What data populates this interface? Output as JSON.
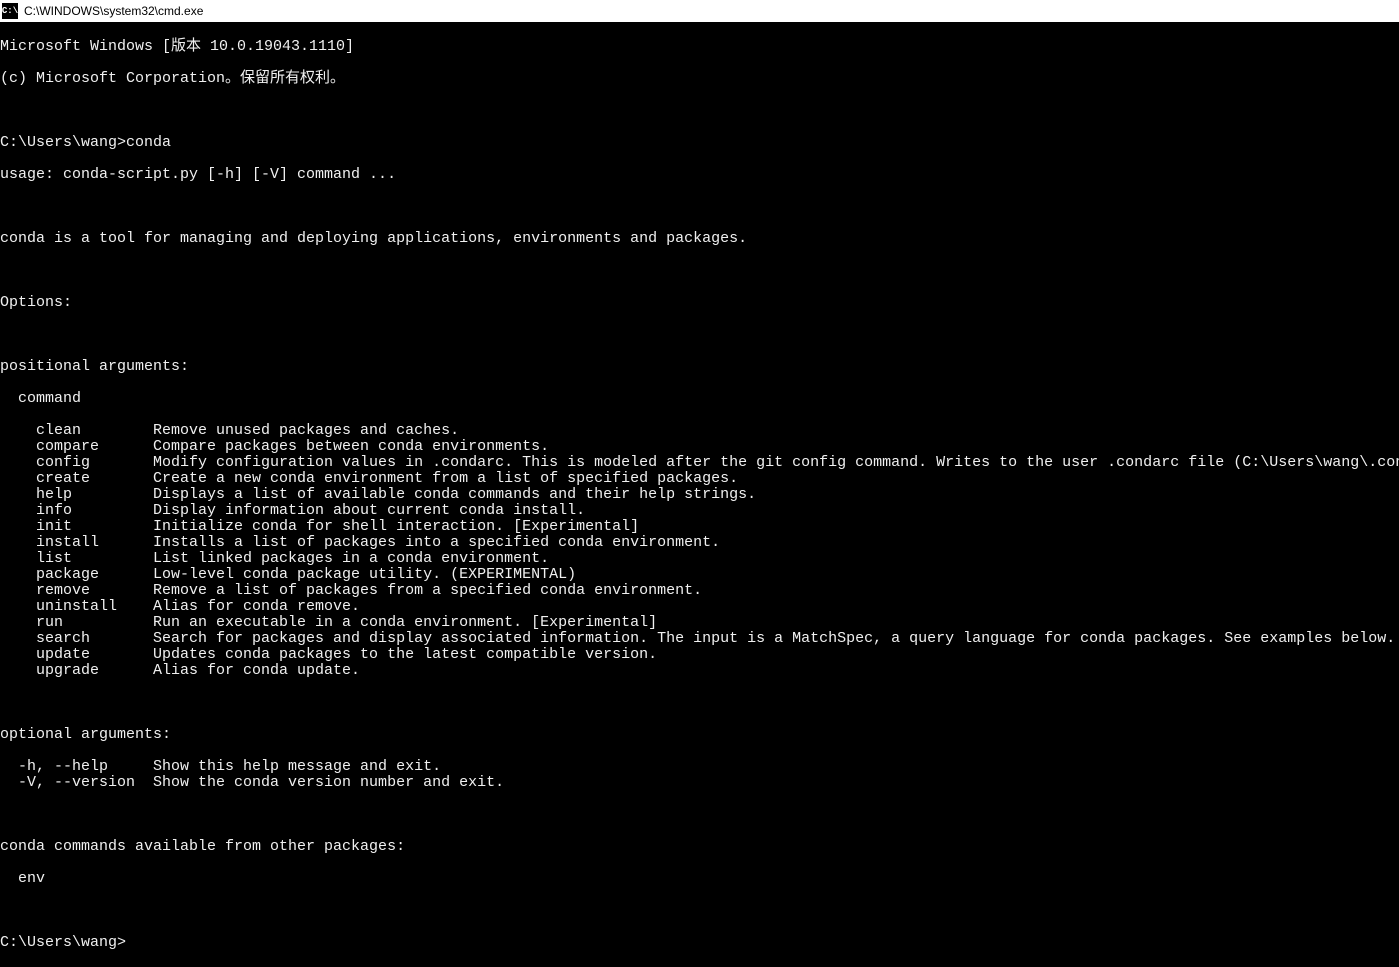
{
  "title_bar": {
    "icon_label": "C:\\",
    "title": "C:\\WINDOWS\\system32\\cmd.exe"
  },
  "terminal": {
    "header1": "Microsoft Windows [版本 10.0.19043.1110]",
    "header2": "(c) Microsoft Corporation。保留所有权利。",
    "prompt1": "C:\\Users\\wang>conda",
    "usage": "usage: conda-script.py [-h] [-V] command ...",
    "description": "conda is a tool for managing and deploying applications, environments and packages.",
    "options_header": "Options:",
    "positional_header": "positional arguments:",
    "command_label": "  command",
    "commands": [
      {
        "name": "    clean",
        "pad": "        ",
        "desc": "Remove unused packages and caches."
      },
      {
        "name": "    compare",
        "pad": "      ",
        "desc": "Compare packages between conda environments."
      },
      {
        "name": "    config",
        "pad": "       ",
        "desc": "Modify configuration values in .condarc. This is modeled after the git config command. Writes to the user .condarc file (C:\\Users\\wang\\.condarc) by default."
      },
      {
        "name": "    create",
        "pad": "       ",
        "desc": "Create a new conda environment from a list of specified packages."
      },
      {
        "name": "    help",
        "pad": "         ",
        "desc": "Displays a list of available conda commands and their help strings."
      },
      {
        "name": "    info",
        "pad": "         ",
        "desc": "Display information about current conda install."
      },
      {
        "name": "    init",
        "pad": "         ",
        "desc": "Initialize conda for shell interaction. [Experimental]"
      },
      {
        "name": "    install",
        "pad": "      ",
        "desc": "Installs a list of packages into a specified conda environment."
      },
      {
        "name": "    list",
        "pad": "         ",
        "desc": "List linked packages in a conda environment."
      },
      {
        "name": "    package",
        "pad": "      ",
        "desc": "Low-level conda package utility. (EXPERIMENTAL)"
      },
      {
        "name": "    remove",
        "pad": "       ",
        "desc": "Remove a list of packages from a specified conda environment."
      },
      {
        "name": "    uninstall",
        "pad": "    ",
        "desc": "Alias for conda remove."
      },
      {
        "name": "    run",
        "pad": "          ",
        "desc": "Run an executable in a conda environment. [Experimental]"
      },
      {
        "name": "    search",
        "pad": "       ",
        "desc": "Search for packages and display associated information. The input is a MatchSpec, a query language for conda packages. See examples below."
      },
      {
        "name": "    update",
        "pad": "       ",
        "desc": "Updates conda packages to the latest compatible version."
      },
      {
        "name": "    upgrade",
        "pad": "      ",
        "desc": "Alias for conda update."
      }
    ],
    "optional_header": "optional arguments:",
    "optionals": [
      {
        "flag": "  -h, --help",
        "pad": "     ",
        "desc": "Show this help message and exit."
      },
      {
        "flag": "  -V, --version",
        "pad": "  ",
        "desc": "Show the conda version number and exit."
      }
    ],
    "other_pkgs_header": "conda commands available from other packages:",
    "other_pkgs_item": "  env",
    "prompt2": "C:\\Users\\wang>"
  }
}
